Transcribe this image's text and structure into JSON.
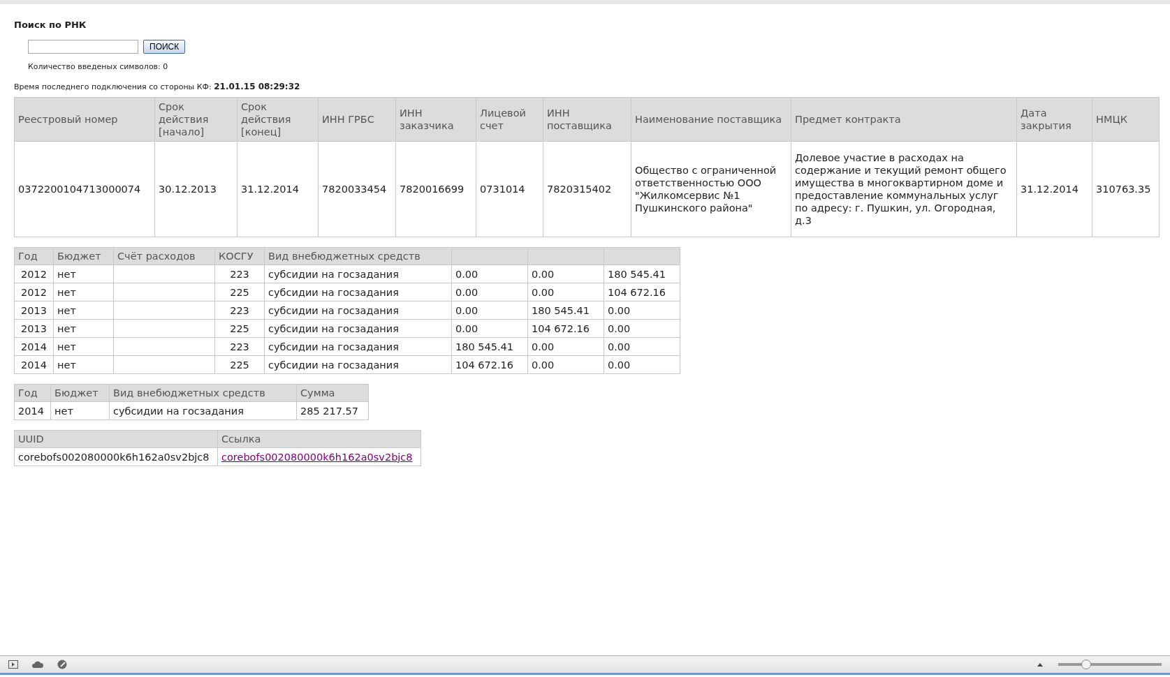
{
  "search": {
    "title": "Поиск по РНК",
    "button": "ПОИСК",
    "counter": "Количество введеных символов: 0"
  },
  "last_connection": {
    "label": "Время последнего подключения со стороны КФ:",
    "value": "21.01.15 08:29:32"
  },
  "contract_table": {
    "columns": [
      "Реестровый номер",
      "Срок действия [начало]",
      "Срок действия [конец]",
      "ИНН ГРБС",
      "ИНН заказчика",
      "Лицевой счет",
      "ИНН поставщика",
      "Наименование поставщика",
      "Предмет контракта",
      "Дата закрытия",
      "НМЦК"
    ],
    "rows": [
      [
        "0372200104713000074",
        "30.12.2013",
        "31.12.2014",
        "7820033454",
        "7820016699",
        "0731014",
        "7820315402",
        "Общество с ограниченной ответственностью ООО \"Жилкомсервис №1 Пушкинского района\"",
        "Долевое участие в расходах на содержание и текущий ремонт общего имущества в многоквартирном доме и предоставление коммунальных услуг по адресу: г. Пушкин, ул. Огородная, д.3",
        "31.12.2014",
        "310763.35"
      ]
    ]
  },
  "finance_table": {
    "columns": [
      "Год",
      "Бюджет",
      "Счёт расходов",
      "КОСГУ",
      "Вид внебюджетных средств"
    ],
    "rows": [
      {
        "year": "2012",
        "budget": "нет",
        "kosgu": "223",
        "fund_type": "субсидии на госзадания",
        "column_6": "0.00",
        "column_7": "0.00",
        "column_8": "180 545.41"
      },
      {
        "year": "2012",
        "budget": "нет",
        "kosgu": "225",
        "fund_type": "субсидии на госзадания",
        "column_6": "0.00",
        "column_7": "0.00",
        "column_8": "104 672.16"
      },
      {
        "year": "2013",
        "budget": "нет",
        "kosgu": "223",
        "fund_type": "субсидии на госзадания",
        "column_6": "0.00",
        "column_7": "180 545.41",
        "column_8": "0.00"
      },
      {
        "year": "2013",
        "budget": "нет",
        "kosgu": "225",
        "fund_type": "субсидии на госзадания",
        "column_6": "0.00",
        "column_7": "104 672.16",
        "column_8": "0.00"
      },
      {
        "year": "2014",
        "budget": "нет",
        "kosgu": "223",
        "fund_type": "субсидии на госзадания",
        "column_6": "180 545.41",
        "column_7": "0.00",
        "column_8": "0.00"
      },
      {
        "year": "2014",
        "budget": "нет",
        "kosgu": "225",
        "fund_type": "субсидии на госзадания",
        "column_6": "104 672.16",
        "column_7": "0.00",
        "column_8": "0.00"
      }
    ]
  },
  "sum_table": {
    "columns": [
      "Год",
      "Бюджет",
      "Вид внебюджетных средств",
      "Сумма"
    ],
    "rows": [
      [
        "2014",
        "нет",
        "субсидии на госзадания",
        "285 217.57"
      ]
    ]
  },
  "uuid_table": {
    "columns": [
      "UUID",
      "Ссылка"
    ],
    "rows": [
      {
        "uuid": "corebofs002080000k6h162a0sv2bjc8",
        "link": "corebofs002080000k6h162a0sv2bjc8"
      }
    ]
  },
  "status_bar": {
    "zoom_slider": {
      "level": 0.27
    }
  }
}
